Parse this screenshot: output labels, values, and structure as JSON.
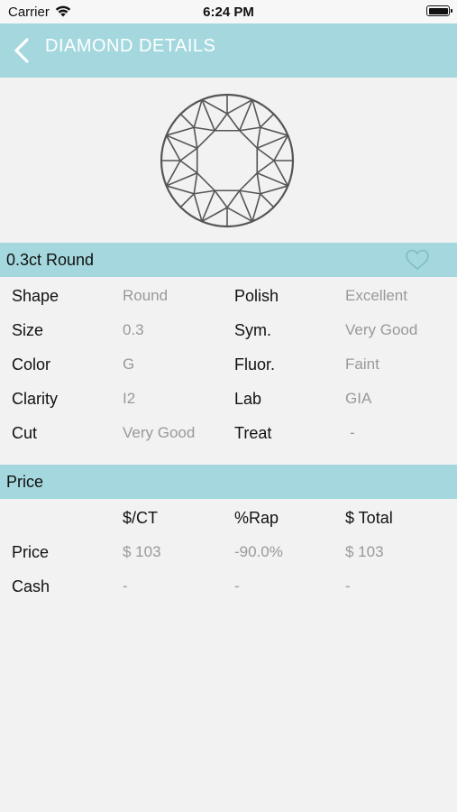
{
  "status_bar": {
    "carrier": "Carrier",
    "time": "6:24 PM"
  },
  "navbar": {
    "title": "DIAMOND DETAILS"
  },
  "summary": {
    "title": "0.3ct Round"
  },
  "details": [
    {
      "k1": "Shape",
      "v1": "Round",
      "k2": "Polish",
      "v2": "Excellent"
    },
    {
      "k1": "Size",
      "v1": "0.3",
      "k2": "Sym.",
      "v2": "Very Good"
    },
    {
      "k1": "Color",
      "v1": "G",
      "k2": "Fluor.",
      "v2": "Faint"
    },
    {
      "k1": "Clarity",
      "v1": "I2",
      "k2": "Lab",
      "v2": "GIA"
    },
    {
      "k1": "Cut",
      "v1": "Very Good",
      "k2": "Treat",
      "v2": "-"
    }
  ],
  "price_section": {
    "title": "Price",
    "headers": [
      "$/CT",
      "%Rap",
      "$ Total"
    ],
    "rows": [
      {
        "label": "Price",
        "per_ct": "$ 103",
        "rap": "-90.0%",
        "total": "$ 103"
      },
      {
        "label": "Cash",
        "per_ct": "-",
        "rap": "-",
        "total": "-"
      }
    ]
  },
  "colors": {
    "accent": "#a4d8de",
    "background": "#f2f2f2",
    "muted_text": "#999999"
  },
  "icons": {
    "back": "chevron-left-icon",
    "favorite": "heart-outline-icon",
    "wifi": "wifi-icon",
    "battery": "battery-icon",
    "diamond": "round-diamond-icon"
  }
}
